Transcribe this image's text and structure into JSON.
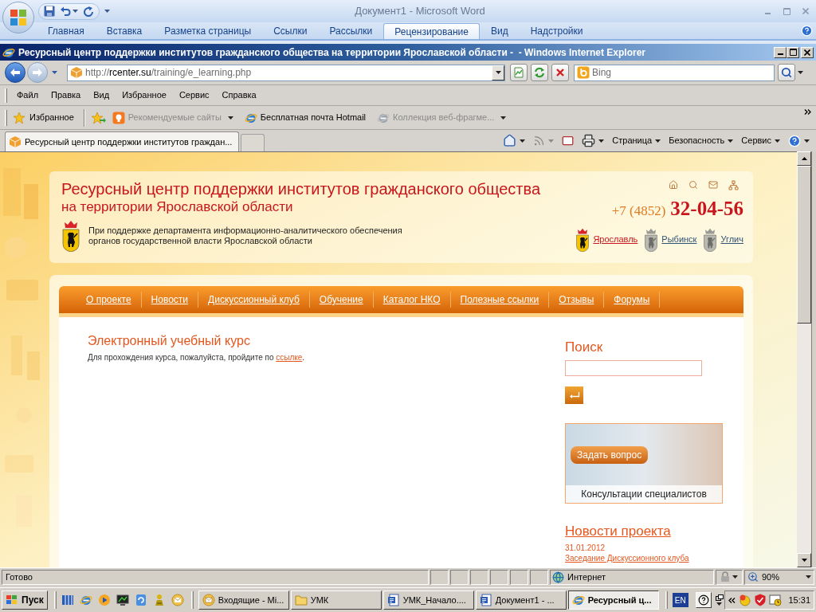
{
  "word_window": {
    "title": "Документ1 - Microsoft Word",
    "tabs": [
      {
        "label": "Главная",
        "selected": false
      },
      {
        "label": "Вставка",
        "selected": false
      },
      {
        "label": "Разметка страницы",
        "selected": false
      },
      {
        "label": "Ссылки",
        "selected": false
      },
      {
        "label": "Рассылки",
        "selected": false
      },
      {
        "label": "Рецензирование",
        "selected": true
      },
      {
        "label": "Вид",
        "selected": false
      },
      {
        "label": "Надстройки",
        "selected": false
      }
    ]
  },
  "browser_window": {
    "title": "Ресурсный центр поддержки институтов гражданского общества на территории Ярославской области -  - Windows Internet Explorer",
    "address": {
      "scheme": "http://",
      "domain": "rcenter.su",
      "path": "/training/e_learning.php"
    },
    "search": {
      "placeholder": "Bing"
    },
    "menu": [
      "Файл",
      "Правка",
      "Вид",
      "Избранное",
      "Сервис",
      "Справка"
    ],
    "favorites_bar": {
      "favorites_button": "Избранное",
      "links": [
        {
          "label": "Рекомендуемые сайты",
          "kind": "suggested",
          "disabled": true,
          "dropdown": true
        },
        {
          "label": "Бесплатная почта Hotmail",
          "kind": "browser",
          "disabled": false,
          "dropdown": false
        },
        {
          "label": "Коллекция веб-фрагме...",
          "kind": "browser",
          "disabled": true,
          "dropdown": true
        }
      ]
    },
    "tabs": [
      {
        "label": "Ресурсный центр поддержки институтов граждан...",
        "selected": true
      }
    ],
    "command_bar": [
      "Страница",
      "Безопасность",
      "Сервис"
    ],
    "status_bar": {
      "text": "Готово",
      "zone": "Интернет",
      "zoom": "90%"
    }
  },
  "page": {
    "header": {
      "title": "Ресурсный центр поддержки институтов гражданского общества",
      "subtitle": "на территории Ярославской области",
      "support": "При поддержке департамента информационно-аналитического обеспечения органов государственной власти Ярославской области",
      "phone_code": "+7 (4852)",
      "phone_number": "32-04-56",
      "cities": [
        {
          "name": "Ярославль",
          "selected": true
        },
        {
          "name": "Рыбинск",
          "selected": false
        },
        {
          "name": "Углич",
          "selected": false
        }
      ]
    },
    "nav": [
      "О проекте",
      "Новости",
      "Дискуссионный клуб",
      "Обучение",
      "Каталог НКО",
      "Полезные ссылки",
      "Отзывы",
      "Форумы"
    ],
    "content": {
      "title": "Электронный учебный курс",
      "text_before": "Для прохождения курса, пожалуйста, пройдите по ",
      "link": "ссылке",
      "text_after": "."
    },
    "sidebar": {
      "search_heading": "Поиск",
      "banner": {
        "button": "Задать вопрос",
        "caption": "Консультации специалистов"
      },
      "news_heading": "Новости проекта",
      "news": [
        {
          "date": "31.01.2012",
          "title": "Заседание Дискуссионного клуба"
        }
      ]
    }
  },
  "taskbar": {
    "start": "Пуск",
    "tasks": [
      {
        "label": "Входящие - Mi...",
        "kind": "mail",
        "selected": false
      },
      {
        "label": "УМК",
        "kind": "folder",
        "selected": false
      },
      {
        "label": "УМК_Начало....",
        "kind": "document",
        "selected": false
      },
      {
        "label": "Документ1 - ...",
        "kind": "document",
        "selected": false
      },
      {
        "label": "Ресурсный ц...",
        "kind": "browser",
        "selected": true
      }
    ],
    "language": "EN",
    "clock": "15:31"
  }
}
